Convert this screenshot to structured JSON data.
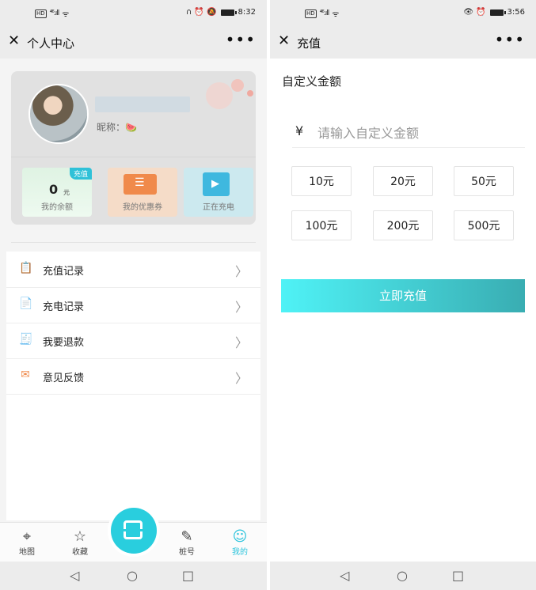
{
  "left": {
    "status": {
      "hd": "HD",
      "network": "⁴⁶.ıll",
      "wifi": "ᯤ",
      "right_icons": "∩ ⏰ 🔕",
      "time": "8:32"
    },
    "title": "个人中心",
    "close": "✕",
    "more": "•••",
    "profile": {
      "nickname_label": "昵称：🍉"
    },
    "tiles": {
      "balance_value": "0",
      "balance_unit": "元",
      "recharge_badge": "充值",
      "balance_label": "我的余额",
      "coupon_label": "我的优惠券",
      "charging_label": "正在充电"
    },
    "menu": [
      {
        "label": "充值记录",
        "icon": "📋",
        "color": "#2fa6c7"
      },
      {
        "label": "充电记录",
        "icon": "📄",
        "color": "#2f5fb0"
      },
      {
        "label": "我要退款",
        "icon": "🧾",
        "color": "#e0453a"
      },
      {
        "label": "意见反馈",
        "icon": "✉",
        "color": "#f08a4b"
      }
    ],
    "chevron": "〉",
    "tabs": [
      {
        "label": "地图",
        "icon": "⌖"
      },
      {
        "label": "收藏",
        "icon": "☆"
      },
      {
        "label": "桩号",
        "icon": "✎"
      },
      {
        "label": "我的",
        "icon": "☺"
      }
    ]
  },
  "right": {
    "status": {
      "hd": "HD",
      "network": "⁴⁶.ıll",
      "wifi": "ᯤ",
      "right_icons": "👁 ⏰",
      "time": "3:56"
    },
    "title": "充值",
    "close": "✕",
    "more": "•••",
    "section_title": "自定义金额",
    "currency": "¥",
    "amount_placeholder": "请输入自定义金额",
    "amounts": [
      "10元",
      "20元",
      "50元",
      "100元",
      "200元",
      "500元"
    ],
    "submit": "立即充值"
  },
  "nav": {
    "back": "◁",
    "home": "○",
    "recent": "□"
  },
  "colors": {
    "accent": "#2cc4dc",
    "cta_start": "#4ff2f6",
    "cta_end": "#39adb2"
  }
}
